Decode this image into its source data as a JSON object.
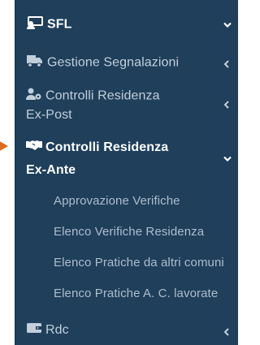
{
  "menu": {
    "sfl": {
      "label": "SFL",
      "icon": "people-chalkboard-icon",
      "state": "expanded"
    },
    "gestione": {
      "label": "Gestione Segnalazioni",
      "icon": "truck-icon",
      "state": "collapsed"
    },
    "controlli_ex_post": {
      "label_line1": "Controlli Residenza",
      "label_line2": "Ex-Post",
      "icon": "user-gear-icon",
      "state": "collapsed"
    },
    "controlli_ex_ante": {
      "label_line1": "Controlli Residenza",
      "label_line2": "Ex-Ante",
      "icon": "handshake-icon",
      "state": "expanded"
    },
    "submenu": [
      {
        "label": "Approvazione Verifiche"
      },
      {
        "label": "Elenco Verifiche Residenza"
      },
      {
        "label": "Elenco Pratiche da altri comuni"
      },
      {
        "label": "Elenco Pratiche A. C. lavorate"
      }
    ],
    "rdc": {
      "label": "Rdc",
      "icon": "wallet-icon",
      "state": "collapsed"
    }
  },
  "colors": {
    "sidebar_bg": "#1f3f5b",
    "pointer": "#e06a1d",
    "text_strong": "#ffffff",
    "text_muted": "#c2cfdb"
  }
}
